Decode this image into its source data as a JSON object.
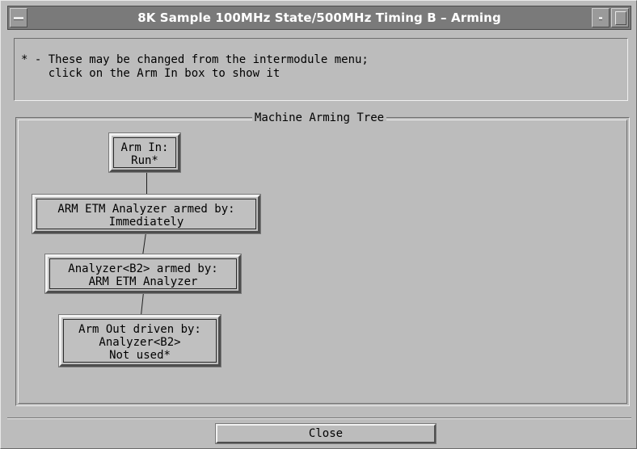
{
  "window": {
    "title": "8K Sample 100MHz State/500MHz Timing  B – Arming",
    "icons": [
      "window-menu-icon",
      "minimize-icon",
      "maximize-icon"
    ]
  },
  "info": {
    "line1": "* - These may be changed from the intermodule menu;",
    "line2": "    click on the Arm In box to show it"
  },
  "tree": {
    "legend": "Machine Arming Tree",
    "nodes": [
      {
        "lines": [
          "Arm In:",
          "Run*"
        ]
      },
      {
        "lines": [
          "ARM ETM Analyzer armed by:",
          "Immediately"
        ]
      },
      {
        "lines": [
          "Analyzer<B2> armed by:",
          "ARM ETM Analyzer"
        ]
      },
      {
        "lines": [
          "Arm Out driven by:",
          "Analyzer<B2>",
          "Not used*"
        ]
      }
    ]
  },
  "footer": {
    "close_label": "Close"
  }
}
